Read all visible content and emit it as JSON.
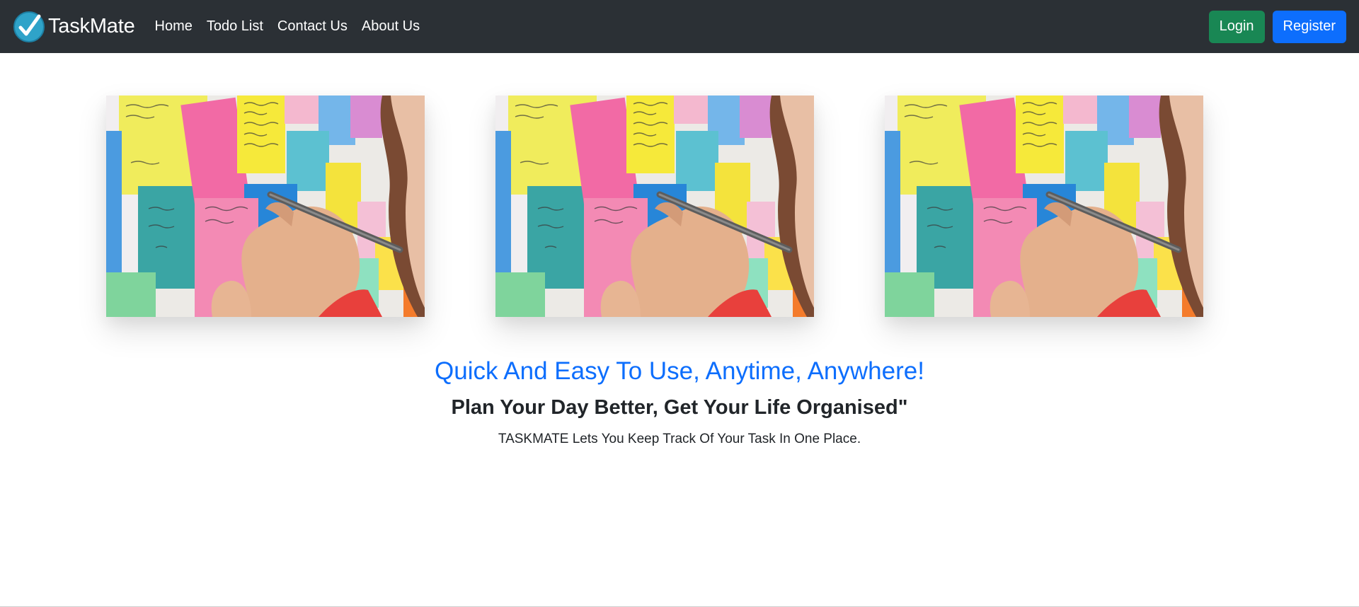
{
  "brand": {
    "name": "TaskMate",
    "logo_icon": "checkmark-circle-icon"
  },
  "nav": {
    "items": [
      {
        "label": "Home"
      },
      {
        "label": "Todo List"
      },
      {
        "label": "Contact Us"
      },
      {
        "label": "About Us"
      }
    ],
    "login_label": "Login",
    "register_label": "Register"
  },
  "gallery": {
    "images": [
      {
        "icon": "sticky-notes-photo"
      },
      {
        "icon": "sticky-notes-photo"
      },
      {
        "icon": "sticky-notes-photo"
      }
    ]
  },
  "hero": {
    "title": "Quick And Easy To Use, Anytime, Anywhere!",
    "subtitle": "Plan Your Day Better, Get Your Life Organised\"",
    "text": "TASKMATE Lets You Keep Track Of Your Task In One Place."
  },
  "colors": {
    "navbar_bg": "#2b3035",
    "login_button": "#198754",
    "register_button": "#0d6efd",
    "hero_title": "#0d6efd"
  }
}
